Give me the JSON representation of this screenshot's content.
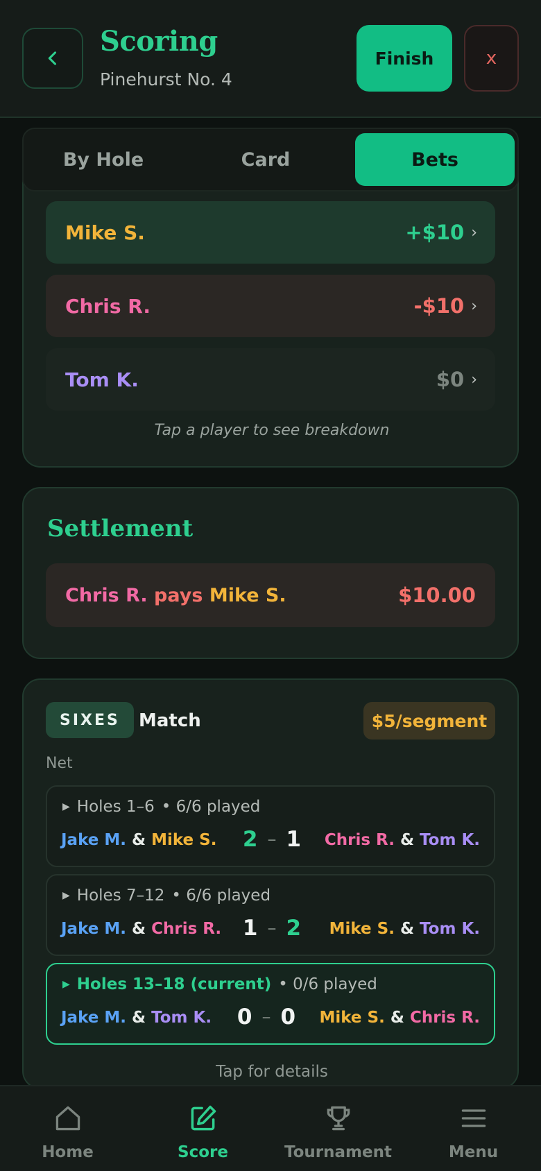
{
  "header": {
    "title": "Scoring",
    "subtitle": "Pinehurst No. 4",
    "finish_label": "Finish",
    "close_label": "x"
  },
  "tabs": [
    {
      "label": "By Hole",
      "active": false
    },
    {
      "label": "Card",
      "active": false
    },
    {
      "label": "Bets",
      "active": true
    }
  ],
  "standings": {
    "players": [
      {
        "name": "Mike S.",
        "amount": "+$10",
        "status": "win"
      },
      {
        "name": "Chris R.",
        "amount": "-$10",
        "status": "lose"
      },
      {
        "name": "Tom K.",
        "amount": "$0",
        "status": "even"
      }
    ],
    "hint": "Tap a player to see breakdown"
  },
  "settlement": {
    "title": "Settlement",
    "payer": "Chris R.",
    "verb": "pays",
    "payee": "Mike S.",
    "amount": "$10.00"
  },
  "sixes": {
    "badge": "SIXES",
    "type": "Match",
    "stake": "$5/segment",
    "scoring": "Net",
    "segments": [
      {
        "holes": "Holes 1–6",
        "current": false,
        "played": "• 6/6 played",
        "left": [
          "Jake M.",
          "Mike S."
        ],
        "right": [
          "Chris R.",
          "Tom K."
        ],
        "score_left": "2",
        "score_right": "1"
      },
      {
        "holes": "Holes 7–12",
        "current": false,
        "played": "• 6/6 played",
        "left": [
          "Jake M.",
          "Chris R."
        ],
        "right": [
          "Mike S.",
          "Tom K."
        ],
        "score_left": "1",
        "score_right": "2"
      },
      {
        "holes": "Holes 13–18 (current)",
        "current": true,
        "played": "• 0/6 played",
        "left": [
          "Jake M.",
          "Tom K."
        ],
        "right": [
          "Mike S.",
          "Chris R."
        ],
        "score_left": "0",
        "score_right": "0"
      }
    ],
    "amp": "&",
    "dash": "–",
    "tap_hint": "Tap for details"
  },
  "nav": [
    {
      "label": "Home",
      "icon": "home-icon",
      "active": false
    },
    {
      "label": "Score",
      "icon": "edit-icon",
      "active": true
    },
    {
      "label": "Tournament",
      "icon": "trophy-icon",
      "active": false
    },
    {
      "label": "Menu",
      "icon": "menu-icon",
      "active": false
    }
  ],
  "colors": {
    "accent": "#12bd84",
    "jake": "#5aa2f5",
    "mike": "#f2b43a",
    "chris": "#f26aa5",
    "tom": "#a98ef5",
    "negative": "#f2706a"
  }
}
